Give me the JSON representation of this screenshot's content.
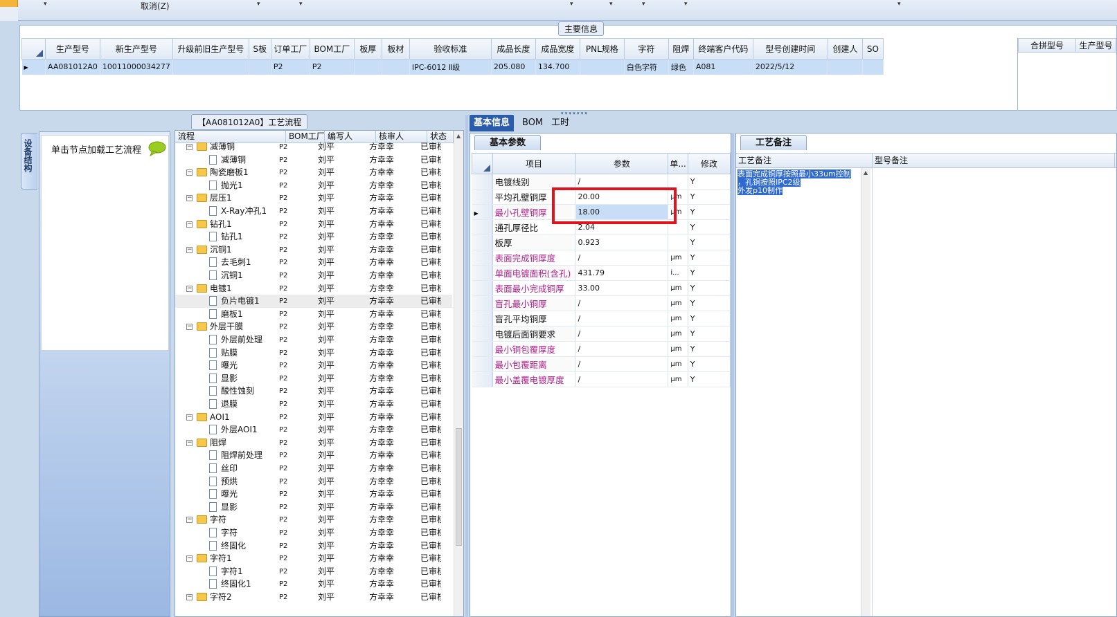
{
  "toolbar": {
    "cancel_label": "取消(Z)",
    "carets": [
      "▾",
      "▾",
      "▾",
      "▾",
      "▾",
      "▾",
      "▾",
      "▾",
      "▾"
    ]
  },
  "main_info": {
    "title": "主要信息",
    "columns": [
      "生产型号",
      "新生产型号",
      "升级前旧生产型号",
      "S板",
      "订单工厂",
      "BOM工厂",
      "板厚",
      "板材",
      "验收标准",
      "成品长度",
      "成品宽度",
      "PNL规格",
      "字符",
      "阻焊",
      "终端客户代码",
      "型号创建时间",
      "创建人",
      "SO"
    ],
    "row": [
      "AA081012A0",
      "10011000034277",
      "",
      "",
      "P2",
      "P2",
      "",
      "",
      "IPC-6012 Ⅱ级",
      "205.080",
      "134.700",
      "",
      "白色字符",
      "绿色",
      "A081",
      "2022/5/12",
      "",
      ""
    ],
    "merge_columns": [
      "合拼型号",
      "生产型号"
    ]
  },
  "flow": {
    "title": "【AA081012A0】工艺流程",
    "side_tab": "设备结构",
    "load_text": "单击节点加载工艺流程",
    "headers": [
      "流程",
      "BOM工厂",
      "编写人",
      "核审人",
      "状态"
    ],
    "rows": [
      {
        "level": 1,
        "type": "folder",
        "name": "减薄铜",
        "bom": "P2",
        "writer": "刘平",
        "reviewer": "方幸幸",
        "status": "已审核"
      },
      {
        "level": 2,
        "type": "doc",
        "name": "减薄铜",
        "bom": "P2",
        "writer": "刘平",
        "reviewer": "方幸幸",
        "status": "已审核"
      },
      {
        "level": 1,
        "type": "folder",
        "name": "陶瓷磨板1",
        "bom": "P2",
        "writer": "刘平",
        "reviewer": "方幸幸",
        "status": "已审核"
      },
      {
        "level": 2,
        "type": "doc",
        "name": "抛光1",
        "bom": "P2",
        "writer": "刘平",
        "reviewer": "方幸幸",
        "status": "已审核"
      },
      {
        "level": 1,
        "type": "folder",
        "name": "层压1",
        "bom": "P2",
        "writer": "刘平",
        "reviewer": "方幸幸",
        "status": "已审核"
      },
      {
        "level": 2,
        "type": "doc",
        "name": "X-Ray冲孔1",
        "bom": "P2",
        "writer": "刘平",
        "reviewer": "方幸幸",
        "status": "已审核"
      },
      {
        "level": 1,
        "type": "folder",
        "name": "钻孔1",
        "bom": "P2",
        "writer": "刘平",
        "reviewer": "方幸幸",
        "status": "已审核"
      },
      {
        "level": 2,
        "type": "doc",
        "name": "钻孔1",
        "bom": "P2",
        "writer": "刘平",
        "reviewer": "方幸幸",
        "status": "已审核"
      },
      {
        "level": 1,
        "type": "folder",
        "name": "沉铜1",
        "bom": "P2",
        "writer": "刘平",
        "reviewer": "方幸幸",
        "status": "已审核"
      },
      {
        "level": 2,
        "type": "doc",
        "name": "去毛刺1",
        "bom": "P2",
        "writer": "刘平",
        "reviewer": "方幸幸",
        "status": "已审核"
      },
      {
        "level": 2,
        "type": "doc",
        "name": "沉铜1",
        "bom": "P2",
        "writer": "刘平",
        "reviewer": "方幸幸",
        "status": "已审核"
      },
      {
        "level": 1,
        "type": "folder",
        "name": "电镀1",
        "bom": "P2",
        "writer": "刘平",
        "reviewer": "方幸幸",
        "status": "已审核"
      },
      {
        "level": 2,
        "type": "doc",
        "name": "负片电镀1",
        "bom": "P2",
        "writer": "刘平",
        "reviewer": "方幸幸",
        "status": "已审核",
        "highlight": true
      },
      {
        "level": 2,
        "type": "doc",
        "name": "磨板1",
        "bom": "P2",
        "writer": "刘平",
        "reviewer": "方幸幸",
        "status": "已审核"
      },
      {
        "level": 1,
        "type": "folder",
        "name": "外层干膜",
        "bom": "P2",
        "writer": "刘平",
        "reviewer": "方幸幸",
        "status": "已审核"
      },
      {
        "level": 2,
        "type": "doc",
        "name": "外层前处理",
        "bom": "P2",
        "writer": "刘平",
        "reviewer": "方幸幸",
        "status": "已审核"
      },
      {
        "level": 2,
        "type": "doc",
        "name": "贴膜",
        "bom": "P2",
        "writer": "刘平",
        "reviewer": "方幸幸",
        "status": "已审核"
      },
      {
        "level": 2,
        "type": "doc",
        "name": "曝光",
        "bom": "P2",
        "writer": "刘平",
        "reviewer": "方幸幸",
        "status": "已审核"
      },
      {
        "level": 2,
        "type": "doc",
        "name": "显影",
        "bom": "P2",
        "writer": "刘平",
        "reviewer": "方幸幸",
        "status": "已审核"
      },
      {
        "level": 2,
        "type": "doc",
        "name": "酸性蚀刻",
        "bom": "P2",
        "writer": "刘平",
        "reviewer": "方幸幸",
        "status": "已审核"
      },
      {
        "level": 2,
        "type": "doc",
        "name": "退膜",
        "bom": "P2",
        "writer": "刘平",
        "reviewer": "方幸幸",
        "status": "已审核"
      },
      {
        "level": 1,
        "type": "folder",
        "name": "AOI1",
        "bom": "P2",
        "writer": "刘平",
        "reviewer": "方幸幸",
        "status": "已审核"
      },
      {
        "level": 2,
        "type": "doc",
        "name": "外层AOI1",
        "bom": "P2",
        "writer": "刘平",
        "reviewer": "方幸幸",
        "status": "已审核"
      },
      {
        "level": 1,
        "type": "folder",
        "name": "阻焊",
        "bom": "P2",
        "writer": "刘平",
        "reviewer": "方幸幸",
        "status": "已审核"
      },
      {
        "level": 2,
        "type": "doc",
        "name": "阻焊前处理",
        "bom": "P2",
        "writer": "刘平",
        "reviewer": "方幸幸",
        "status": "已审核"
      },
      {
        "level": 2,
        "type": "doc",
        "name": "丝印",
        "bom": "P2",
        "writer": "刘平",
        "reviewer": "方幸幸",
        "status": "已审核"
      },
      {
        "level": 2,
        "type": "doc",
        "name": "预烘",
        "bom": "P2",
        "writer": "刘平",
        "reviewer": "方幸幸",
        "status": "已审核"
      },
      {
        "level": 2,
        "type": "doc",
        "name": "曝光",
        "bom": "P2",
        "writer": "刘平",
        "reviewer": "方幸幸",
        "status": "已审核"
      },
      {
        "level": 2,
        "type": "doc",
        "name": "显影",
        "bom": "P2",
        "writer": "刘平",
        "reviewer": "方幸幸",
        "status": "已审核"
      },
      {
        "level": 1,
        "type": "folder",
        "name": "字符",
        "bom": "P2",
        "writer": "刘平",
        "reviewer": "方幸幸",
        "status": "已审核"
      },
      {
        "level": 2,
        "type": "doc",
        "name": "字符",
        "bom": "P2",
        "writer": "刘平",
        "reviewer": "方幸幸",
        "status": "已审核"
      },
      {
        "level": 2,
        "type": "doc",
        "name": "终固化",
        "bom": "P2",
        "writer": "刘平",
        "reviewer": "方幸幸",
        "status": "已审核"
      },
      {
        "level": 1,
        "type": "folder",
        "name": "字符1",
        "bom": "P2",
        "writer": "刘平",
        "reviewer": "方幸幸",
        "status": "已审核"
      },
      {
        "level": 2,
        "type": "doc",
        "name": "字符1",
        "bom": "P2",
        "writer": "刘平",
        "reviewer": "方幸幸",
        "status": "已审核"
      },
      {
        "level": 2,
        "type": "doc",
        "name": "终固化1",
        "bom": "P2",
        "writer": "刘平",
        "reviewer": "方幸幸",
        "status": "已审核"
      },
      {
        "level": 1,
        "type": "folder",
        "name": "字符2",
        "bom": "P2",
        "writer": "刘平",
        "reviewer": "方幸幸",
        "status": "已审核"
      }
    ]
  },
  "tabs": [
    "基本信息",
    "BOM",
    "工时"
  ],
  "basic": {
    "subtab": "基本参数",
    "headers": [
      "项目",
      "参数",
      "单...",
      "修改"
    ],
    "rows": [
      {
        "item": "电镀线别",
        "param": "/",
        "unit": "",
        "mod": "Y",
        "purple": false
      },
      {
        "item": "平均孔壁铜厚",
        "param": "20.00",
        "unit": "μm",
        "mod": "Y",
        "purple": false
      },
      {
        "item": "最小孔壁铜厚",
        "param": "18.00",
        "unit": "μm",
        "mod": "Y",
        "purple": true,
        "selected": true
      },
      {
        "item": "通孔厚径比",
        "param": "2.04",
        "unit": "",
        "mod": "Y",
        "purple": false
      },
      {
        "item": "板厚",
        "param": "0.923",
        "unit": "",
        "mod": "Y",
        "purple": false
      },
      {
        "item": "表面完成铜厚度",
        "param": "/",
        "unit": "μm",
        "mod": "Y",
        "purple": true
      },
      {
        "item": "单面电镀面积(含孔)",
        "param": "431.79",
        "unit": "i...",
        "mod": "Y",
        "purple": true
      },
      {
        "item": "表面最小完成铜厚",
        "param": "33.00",
        "unit": "μm",
        "mod": "Y",
        "purple": true
      },
      {
        "item": "盲孔最小铜厚",
        "param": "/",
        "unit": "μm",
        "mod": "Y",
        "purple": true
      },
      {
        "item": "盲孔平均铜厚",
        "param": "/",
        "unit": "μm",
        "mod": "Y",
        "purple": false
      },
      {
        "item": "电镀后面铜要求",
        "param": "/",
        "unit": "μm",
        "mod": "Y",
        "purple": false
      },
      {
        "item": "最小铜包覆厚度",
        "param": "/",
        "unit": "μm",
        "mod": "Y",
        "purple": true
      },
      {
        "item": "最小包覆距离",
        "param": "/",
        "unit": "μm",
        "mod": "Y",
        "purple": true
      },
      {
        "item": "最小盖覆电镀厚度",
        "param": "/",
        "unit": "μm",
        "mod": "Y",
        "purple": true
      }
    ]
  },
  "notes": {
    "subtab": "工艺备注",
    "headers": [
      "工艺备注",
      "型号备注"
    ],
    "note_lines": [
      "表面完成铜厚按照最小33um控制",
      "，孔铜按照IPC2级",
      "外发p10制作"
    ]
  },
  "colors": {
    "accent": "#2a5caa",
    "highlight_box": "#e0141e",
    "purple_text": "#b0208a",
    "selection": "#c8def6"
  }
}
